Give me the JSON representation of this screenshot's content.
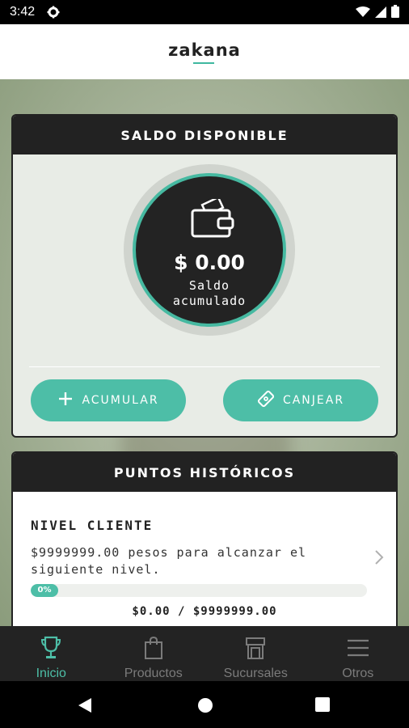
{
  "status_bar": {
    "time": "3:42"
  },
  "app": {
    "logo_left": "za",
    "logo_ka": "ka",
    "logo_right": "na"
  },
  "saldo_card": {
    "title": "SALDO DISPONIBLE",
    "amount": "$ 0.00",
    "label_line1": "Saldo",
    "label_line2": "acumulado",
    "accumulate_button": "ACUMULAR",
    "redeem_button": "CANJEAR"
  },
  "puntos_card": {
    "title": "PUNTOS HISTÓRICOS",
    "level_title": "NIVEL CLIENTE",
    "level_description": "$9999999.00 pesos para alcanzar el siguiente nivel.",
    "progress_label": "0%",
    "progress_fraction": 0,
    "progress_text": "$0.00 / $9999999.00"
  },
  "tabs": [
    {
      "label": "Inicio",
      "icon": "trophy-icon",
      "active": true
    },
    {
      "label": "Productos",
      "icon": "shopping-bag-icon",
      "active": false
    },
    {
      "label": "Sucursales",
      "icon": "store-icon",
      "active": false
    },
    {
      "label": "Otros",
      "icon": "menu-icon",
      "active": false
    }
  ],
  "colors": {
    "accent": "#4dbea7",
    "dark": "#232323",
    "card_bg": "#e8ece6"
  }
}
